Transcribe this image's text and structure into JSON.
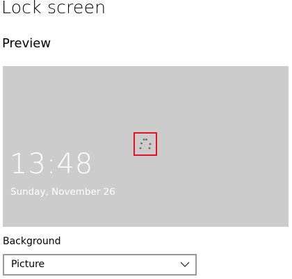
{
  "header": {
    "title": "Lock screen"
  },
  "preview": {
    "section_title": "Preview",
    "background_color": "#cccccc",
    "time": "13:48",
    "date": "Sunday, November 26",
    "loading_indicator": "loading-spinner-icon",
    "highlight_color": "#e81123"
  },
  "background": {
    "label": "Background",
    "selected": "Picture",
    "icon": "chevron-down-icon"
  }
}
